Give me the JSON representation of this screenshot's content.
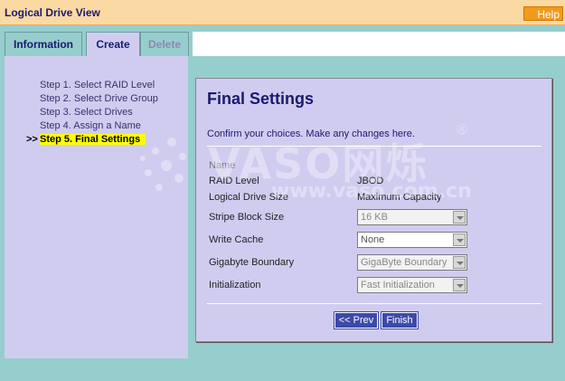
{
  "window": {
    "title": "Logical Drive View",
    "help_label": "Help"
  },
  "tabs": [
    {
      "label": "Information",
      "state": "normal"
    },
    {
      "label": "Create",
      "state": "active"
    },
    {
      "label": "Delete",
      "state": "disabled"
    }
  ],
  "steps": [
    {
      "label": "Step 1. Select RAID Level",
      "current": false
    },
    {
      "label": "Step 2. Select Drive Group",
      "current": false
    },
    {
      "label": "Step 3. Select Drives",
      "current": false
    },
    {
      "label": "Step 4. Assign a Name",
      "current": false
    },
    {
      "label": "Step 5. Final Settings",
      "current": true,
      "marker": ">>"
    }
  ],
  "panel": {
    "title": "Final Settings",
    "subtitle": "Confirm your choices. Make any changes here.",
    "fields": {
      "name": {
        "label": "Name",
        "value": ""
      },
      "raid_level": {
        "label": "RAID Level",
        "value": "JBOD"
      },
      "logical_drive_size": {
        "label": "Logical Drive Size",
        "value": "Maximum Capacity"
      },
      "stripe_block_size": {
        "label": "Stripe Block Size",
        "value": "16 KB",
        "disabled": true
      },
      "write_cache": {
        "label": "Write Cache",
        "value": "None",
        "disabled": false
      },
      "gigabyte_boundary": {
        "label": "Gigabyte Boundary",
        "value": "GigaByte Boundary",
        "disabled": true
      },
      "initialization": {
        "label": "Initialization",
        "value": "Fast Initialization",
        "disabled": true
      }
    },
    "buttons": {
      "prev": "<< Prev",
      "finish": "Finish"
    }
  },
  "watermark": {
    "text": "VASO网烁",
    "url": "www.vaso.com.cn",
    "reg": "®"
  },
  "colors": {
    "background": "#96cdcd",
    "panel": "#d0ccf0",
    "titlebar": "#fbd9a3",
    "help": "#f39a1c",
    "button": "#3d4aa8",
    "highlight": "#ffff00",
    "heading": "#1a1a6e"
  }
}
